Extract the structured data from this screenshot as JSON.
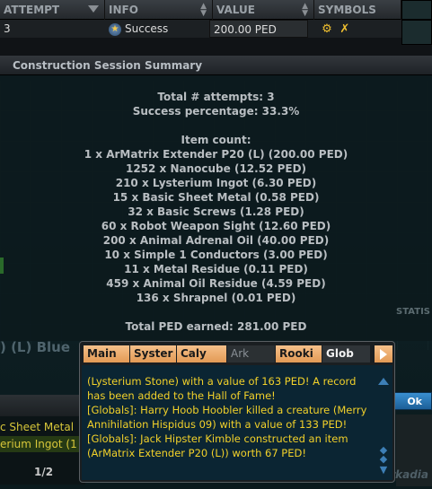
{
  "table": {
    "columns": [
      "ATTEMPT",
      "INFO",
      "VALUE",
      "SYMBOLS"
    ],
    "row": {
      "attempt": "3",
      "info": "Success",
      "value": "200.00 PED"
    }
  },
  "panel": {
    "title": "Construction Session Summary",
    "lines": [
      "Total # attempts: 3",
      "Success percentage: 33.3%",
      "",
      "Item count:",
      "1 x ArMatrix Extender P20 (L) (200.00 PED)",
      "1252 x Nanocube (12.52 PED)",
      "210 x Lysterium Ingot (6.30 PED)",
      "15 x Basic Sheet Metal (0.58 PED)",
      "32 x Basic Screws (1.28 PED)",
      "60 x Robot Weapon Sight (12.60 PED)",
      "200 x Animal Adrenal Oil (40.00 PED)",
      "10 x Simple 1 Conductors (3.00 PED)",
      "11 x Metal Residue (0.11 PED)",
      "459 x Animal Oil Residue (4.59 PED)",
      "136 x Shrapnel (0.01 PED)",
      "",
      "Total PED earned: 281.00 PED"
    ]
  },
  "background": {
    "left_label": ") (L) Blue",
    "stat_label": "STATIS",
    "left_list": [
      "c Sheet Metal",
      "erium Ingot (1"
    ],
    "pager": "1/2",
    "ok_label": "Ok",
    "brand": "Arkadia"
  },
  "chat": {
    "tabs": [
      "Main",
      "Syster",
      "Caly",
      "Ark",
      "Rooki",
      "Glob"
    ],
    "active_tab": "Glob",
    "messages": [
      "(Lysterium Stone) with a value of 163 PED! A record has been added to the Hall of Fame!",
      "[Globals]: Harry Hoob Hoobler killed a creature (Merry Annihilation Hispidus 09) with a value of 133 PED!",
      "[Globals]: Jack Hipster Kimble constructed an item (ArMatrix Extender P20 (L)) worth 67 PED!"
    ]
  },
  "colors": {
    "chat_text": "#f2d12a",
    "tab_orange": "#e39a55",
    "ok_blue": "#1c5f98",
    "panel_bg": "#0d1a1e"
  }
}
